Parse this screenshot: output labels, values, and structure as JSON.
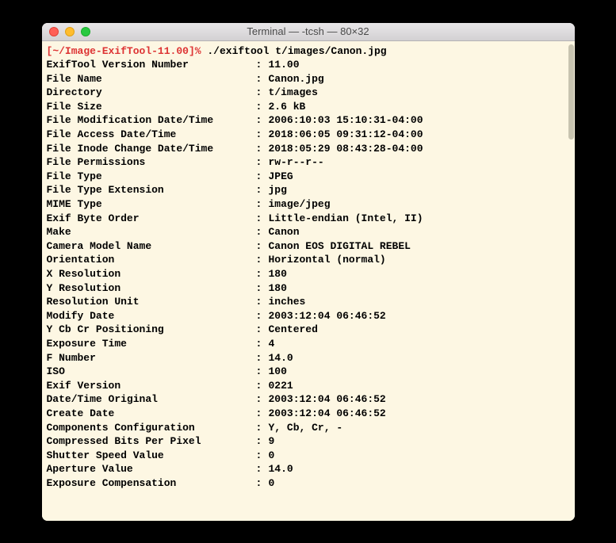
{
  "window": {
    "title": "Terminal — -tcsh — 80×32"
  },
  "prompt": {
    "prefix": "[",
    "path": "~/Image-ExifTool-11.00",
    "suffix": "]%",
    "command": "./exiftool t/images/Canon.jpg"
  },
  "rows": [
    {
      "label": "ExifTool Version Number",
      "value": "11.00"
    },
    {
      "label": "File Name",
      "value": "Canon.jpg"
    },
    {
      "label": "Directory",
      "value": "t/images"
    },
    {
      "label": "File Size",
      "value": "2.6 kB"
    },
    {
      "label": "File Modification Date/Time",
      "value": "2006:10:03 15:10:31-04:00"
    },
    {
      "label": "File Access Date/Time",
      "value": "2018:06:05 09:31:12-04:00"
    },
    {
      "label": "File Inode Change Date/Time",
      "value": "2018:05:29 08:43:28-04:00"
    },
    {
      "label": "File Permissions",
      "value": "rw-r--r--"
    },
    {
      "label": "File Type",
      "value": "JPEG"
    },
    {
      "label": "File Type Extension",
      "value": "jpg"
    },
    {
      "label": "MIME Type",
      "value": "image/jpeg"
    },
    {
      "label": "Exif Byte Order",
      "value": "Little-endian (Intel, II)"
    },
    {
      "label": "Make",
      "value": "Canon"
    },
    {
      "label": "Camera Model Name",
      "value": "Canon EOS DIGITAL REBEL"
    },
    {
      "label": "Orientation",
      "value": "Horizontal (normal)"
    },
    {
      "label": "X Resolution",
      "value": "180"
    },
    {
      "label": "Y Resolution",
      "value": "180"
    },
    {
      "label": "Resolution Unit",
      "value": "inches"
    },
    {
      "label": "Modify Date",
      "value": "2003:12:04 06:46:52"
    },
    {
      "label": "Y Cb Cr Positioning",
      "value": "Centered"
    },
    {
      "label": "Exposure Time",
      "value": "4"
    },
    {
      "label": "F Number",
      "value": "14.0"
    },
    {
      "label": "ISO",
      "value": "100"
    },
    {
      "label": "Exif Version",
      "value": "0221"
    },
    {
      "label": "Date/Time Original",
      "value": "2003:12:04 06:46:52"
    },
    {
      "label": "Create Date",
      "value": "2003:12:04 06:46:52"
    },
    {
      "label": "Components Configuration",
      "value": "Y, Cb, Cr, -"
    },
    {
      "label": "Compressed Bits Per Pixel",
      "value": "9"
    },
    {
      "label": "Shutter Speed Value",
      "value": "0"
    },
    {
      "label": "Aperture Value",
      "value": "14.0"
    },
    {
      "label": "Exposure Compensation",
      "value": "0"
    }
  ]
}
